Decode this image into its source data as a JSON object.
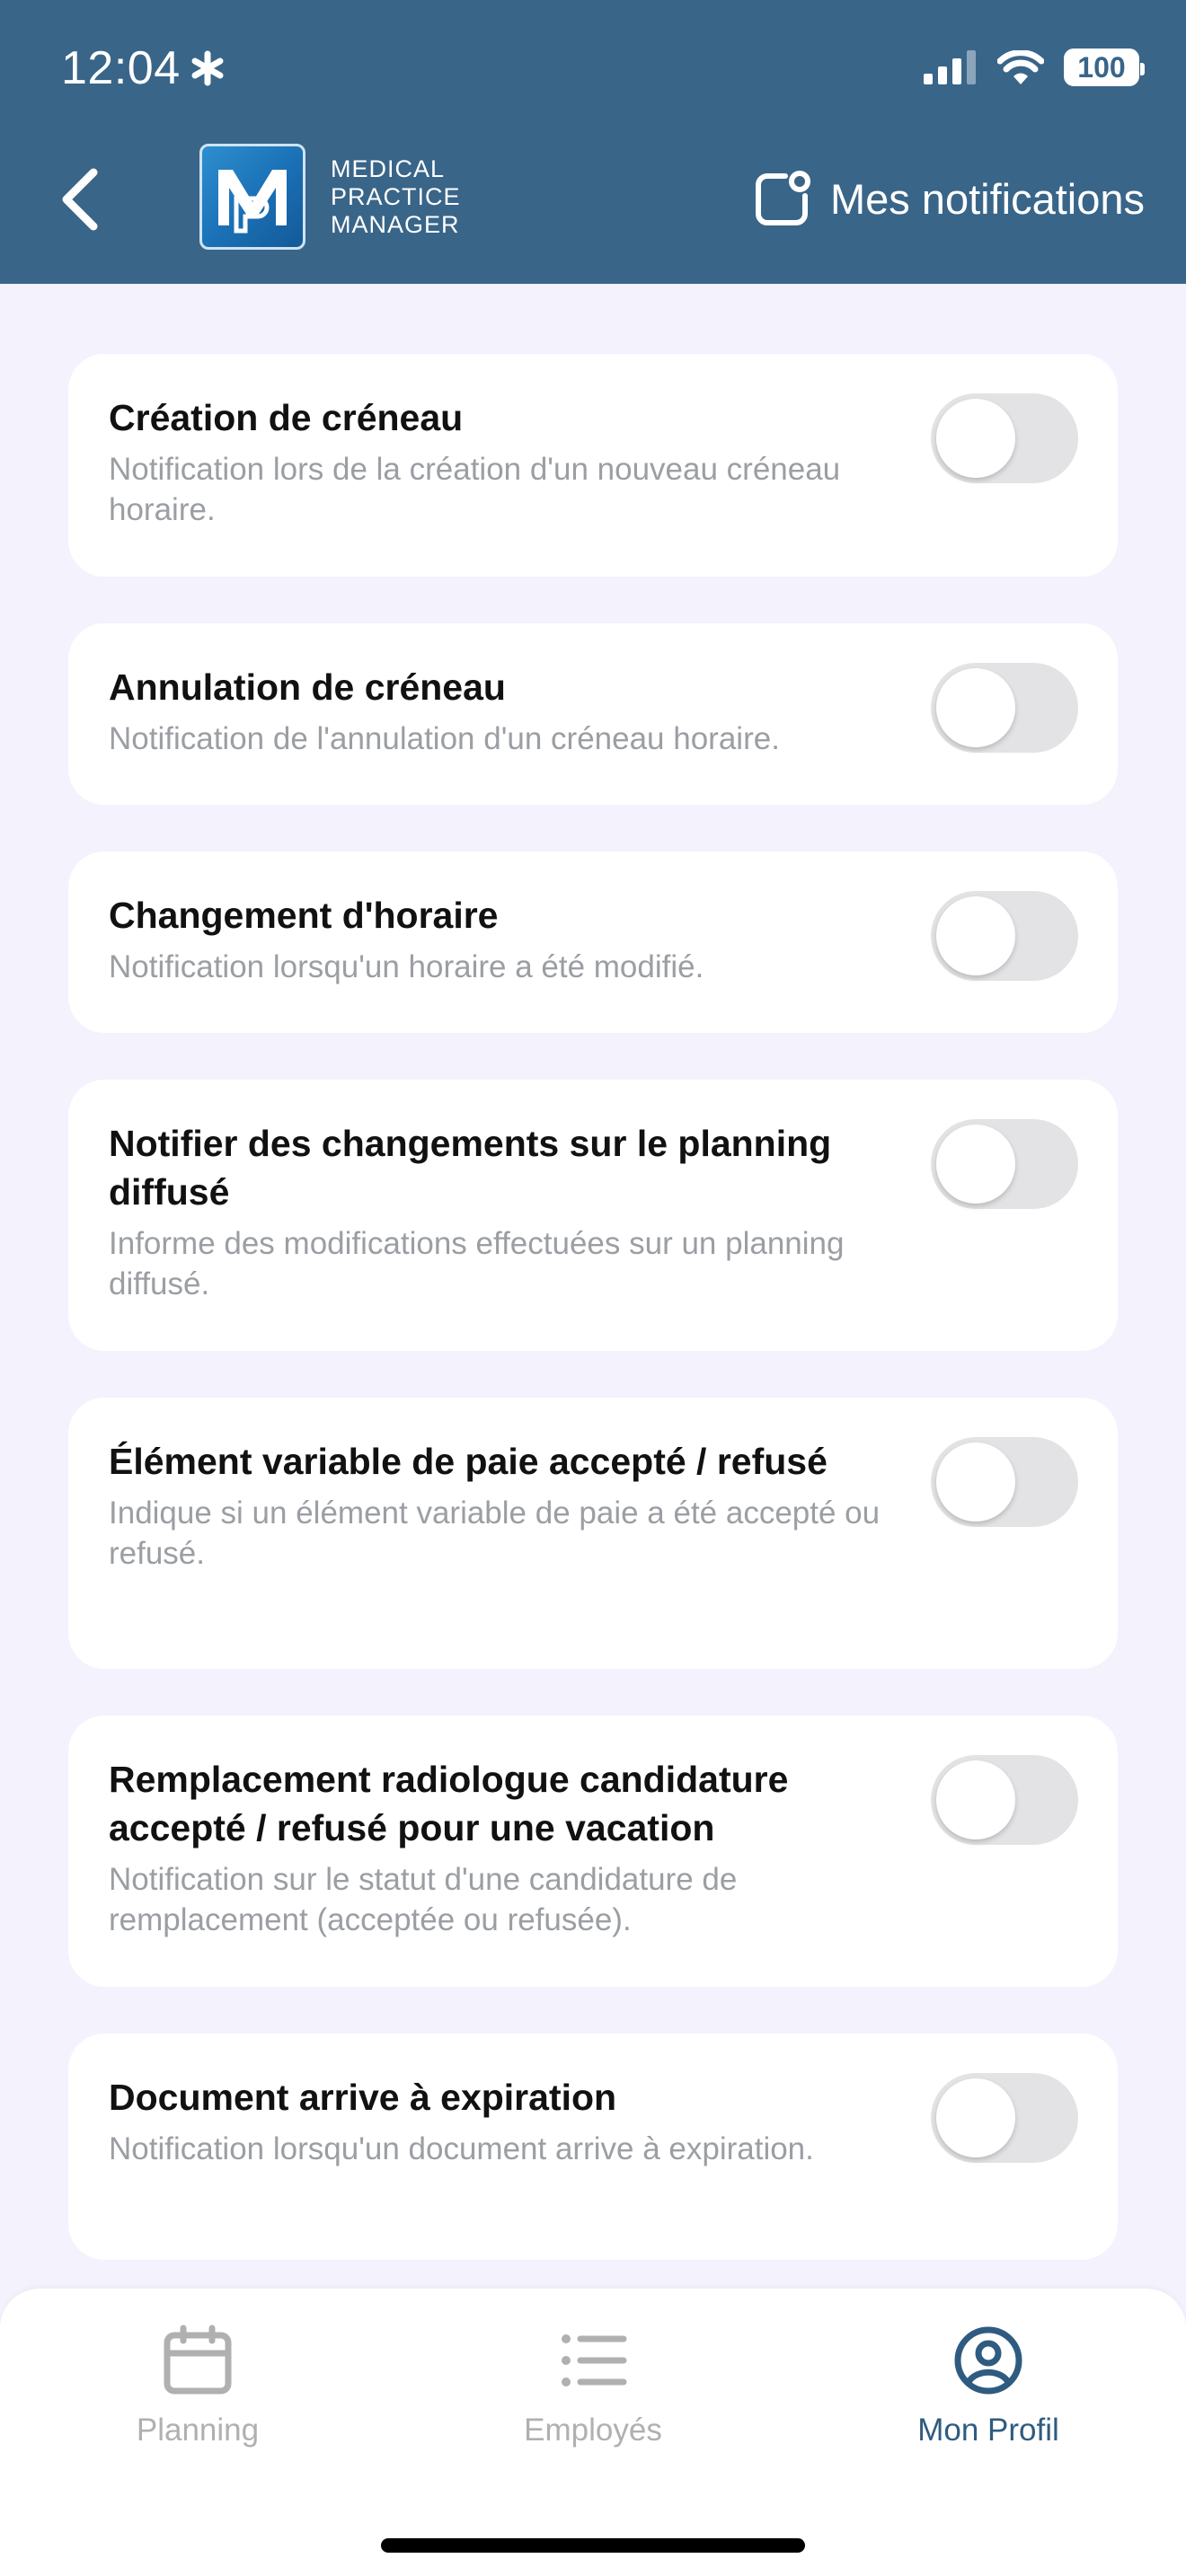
{
  "status_bar": {
    "time": "12:04",
    "battery": "100"
  },
  "header": {
    "logo_lines": [
      "MEDICAL",
      "PRACTICE",
      "MANAGER"
    ],
    "title": "Mes notifications"
  },
  "settings": [
    {
      "title": "Création de créneau",
      "description": "Notification lors de la création d'un nouveau créneau horaire.",
      "enabled": false
    },
    {
      "title": "Annulation de créneau",
      "description": "Notification de l'annulation d'un créneau horaire.",
      "enabled": false
    },
    {
      "title": "Changement d'horaire",
      "description": "Notification lorsqu'un horaire a été modifié.",
      "enabled": false
    },
    {
      "title": "Notifier des changements sur le planning diffusé",
      "description": "Informe des modifications effectuées sur un planning diffusé.",
      "enabled": false
    },
    {
      "title": "Élément variable de paie accepté / refusé",
      "description": "Indique si un élément variable de paie a été accepté ou refusé.",
      "enabled": false
    },
    {
      "title": "Remplacement radiologue candidature accepté / refusé pour une vacation",
      "description": "Notification sur le statut d'une candidature de remplacement (acceptée ou refusée).",
      "enabled": false
    },
    {
      "title": "Document arrive à expiration",
      "description": "Notification lorsqu'un document arrive à expiration.",
      "enabled": false
    }
  ],
  "tabbar": {
    "tabs": [
      {
        "label": "Planning",
        "icon": "calendar-icon",
        "active": false
      },
      {
        "label": "Employés",
        "icon": "list-icon",
        "active": false
      },
      {
        "label": "Mon Profil",
        "icon": "user-circle-icon",
        "active": true
      }
    ]
  },
  "colors": {
    "header": "#396589",
    "background": "#f3f2fd",
    "active_tab": "#2f5b80",
    "inactive_tab": "#b0b0b0",
    "toggle_off": "#e3e3e6"
  }
}
